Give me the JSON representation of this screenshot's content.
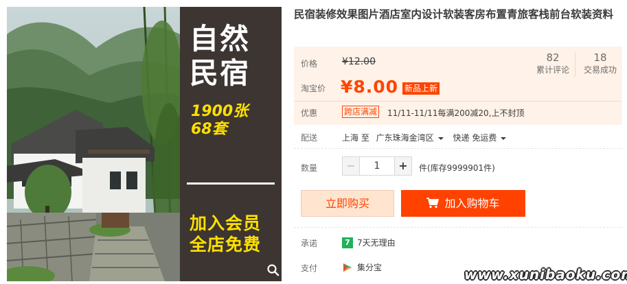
{
  "product": {
    "title": "民宿装修效果图片酒店室内设计软装客房布置青旅客栈前台软装资料"
  },
  "promo_banner": {
    "headline": "自然民宿",
    "count_text": "1900张\n68套",
    "bottom_text": "加入会员\n全店免费"
  },
  "price": {
    "label": "价格",
    "original": "¥12.00",
    "tao_label": "淘宝价",
    "tao_price": "¥8.00",
    "new_tag": "新品上新"
  },
  "stats": [
    {
      "num": "82",
      "label": "累计评论"
    },
    {
      "num": "18",
      "label": "交易成功"
    }
  ],
  "promotion": {
    "label": "优惠",
    "tag": "跨店满减",
    "text": "11/11-11/11每满200减20,上不封顶"
  },
  "shipping": {
    "label": "配送",
    "from": "上海 至",
    "to": "广东珠海金湾区",
    "fee": "快递 免运费"
  },
  "quantity": {
    "label": "数量",
    "minus": "−",
    "value": "1",
    "plus": "+",
    "stock": "件(库存9999901件)"
  },
  "actions": {
    "buy_now": "立即购买",
    "add_to_cart": "加入购物车"
  },
  "guarantee": {
    "label": "承诺",
    "icon_text": "7",
    "text": "7天无理由"
  },
  "payment": {
    "label": "支付",
    "text": "集分宝"
  },
  "watermark": "www.xunibaoku.com",
  "colors": {
    "accent": "#ff4400",
    "cart_button": "#ff4200",
    "buy_button_bg": "#ffe4d0",
    "price_box_bg": "#fff2e8",
    "panel_bg": "#3c3532",
    "promo_yellow": "#ffe000",
    "guarantee_green": "#21b15a"
  },
  "icons": {
    "zoom": "magnifier-icon",
    "cart": "shopping-cart-icon",
    "guarantee": "seven-day-return-icon",
    "payment": "jifenbao-icon"
  }
}
